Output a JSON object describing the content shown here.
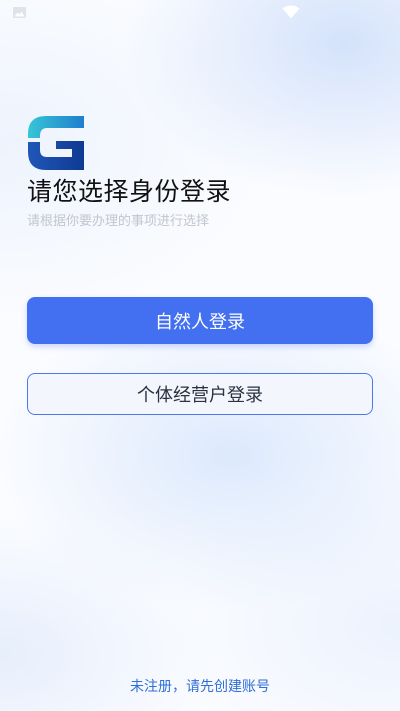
{
  "status_bar": {
    "left_icon": "image-icon",
    "right_icon": "wifi-icon"
  },
  "header": {
    "logo_icon": "g-logo-icon",
    "title": "请您选择身份登录",
    "subtitle": "请根据你要办理的事项进行选择"
  },
  "options": {
    "natural_person_label": "自然人登录",
    "business_label": "个体经营户登录"
  },
  "footer": {
    "register_label": "未注册，请先创建账号"
  },
  "colors": {
    "primary": "#4370f0",
    "link": "#2f6fd8",
    "subtitle": "#c2c6cd"
  }
}
